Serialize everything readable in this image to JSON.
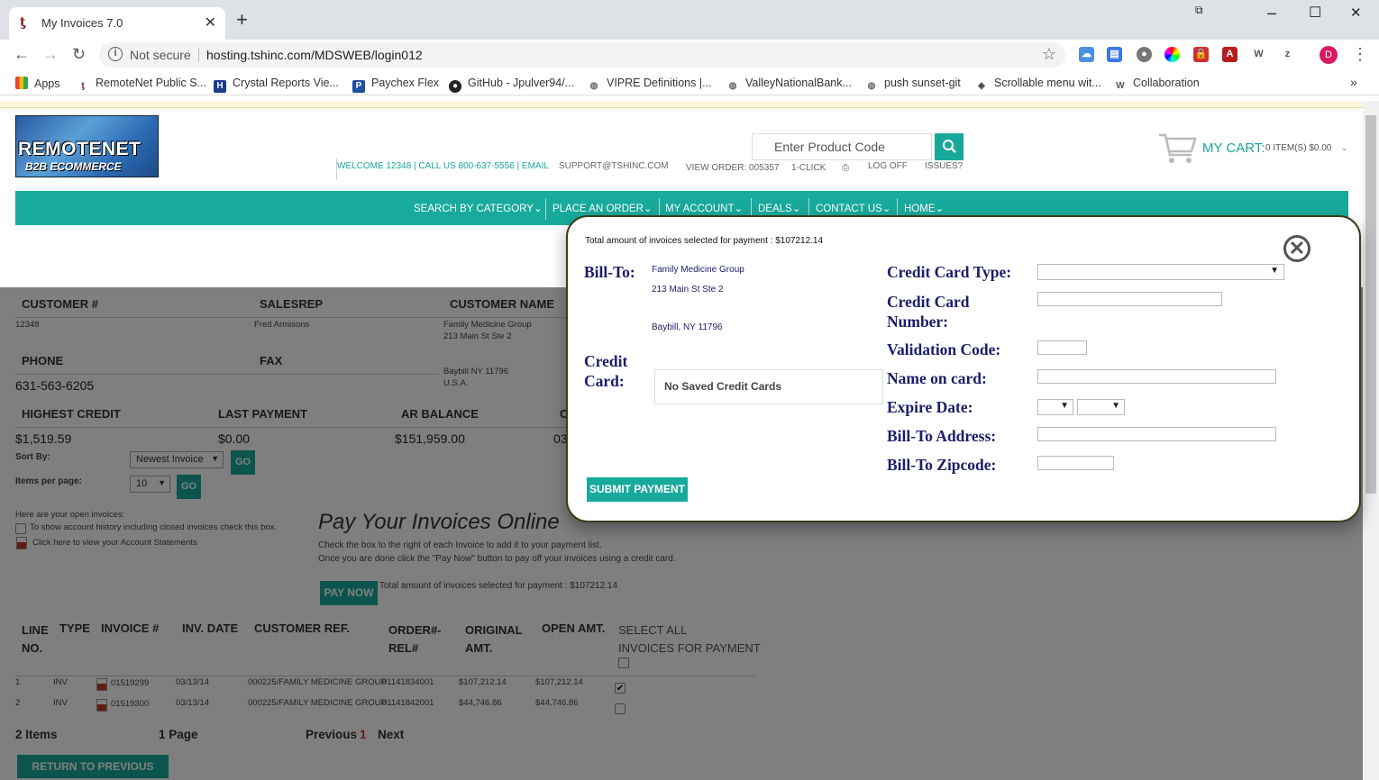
{
  "browser": {
    "tab_title": "My Invoices 7.0",
    "not_secure": "Not secure",
    "url": "hosting.tshinc.com/MDSWEB/login012",
    "bookmarks": [
      {
        "label": "Apps"
      },
      {
        "label": "RemoteNet Public S..."
      },
      {
        "label": "Crystal Reports Vie..."
      },
      {
        "label": "Paychex Flex"
      },
      {
        "label": "GitHub - Jpulver94/..."
      },
      {
        "label": "VIPRE Definitions |..."
      },
      {
        "label": "ValleyNationalBank..."
      },
      {
        "label": "push sunset-git"
      },
      {
        "label": "Scrollable menu wit..."
      },
      {
        "label": "Collaboration"
      }
    ],
    "avatar_letter": "D"
  },
  "site": {
    "logo_line1": "REMOTENET",
    "logo_line2": "B2B ECOMMERCE",
    "search_placeholder": "Enter Product Code",
    "welcome": "WELCOME 12348 | CALL US 800-637-5556 | EMAIL",
    "support_email": "SUPPORT@TSHINC.COM",
    "view_order": "VIEW ORDER: 005357",
    "one_click": "1-CLICK",
    "log_off": "LOG OFF",
    "issues": "ISSUES?",
    "my_cart": "MY CART:",
    "cart_info": "0 ITEM(S) $0.00",
    "nav": [
      "SEARCH BY CATEGORY",
      "PLACE AN ORDER",
      "MY ACCOUNT",
      "DEALS",
      "CONTACT US",
      "HOME"
    ],
    "accent_color": "#18aa9c"
  },
  "account": {
    "headers1": [
      "CUSTOMER #",
      "SALESREP",
      "CUSTOMER NAME"
    ],
    "customer_no": "12348",
    "salesrep": "Fred Armisons",
    "customer_name_lines": [
      "Family Medicine Group",
      "213 Main St Ste 2",
      "",
      "Baybill NY 11796",
      "U.S.A."
    ],
    "headers2": [
      "PHONE",
      "FAX"
    ],
    "phone": "631-563-6205",
    "headers3": [
      "HIGHEST CREDIT",
      "LAST PAYMENT",
      "AR BALANCE",
      "C"
    ],
    "highest_credit": "$1,519.59",
    "last_payment": "$0.00",
    "ar_balance": "$151,959.00",
    "clipped_value": "03"
  },
  "controls": {
    "sort_by_label": "Sort By:",
    "sort_by_value": "Newest Invoice",
    "items_per_page_label": "Items per page:",
    "items_per_page_value": "10",
    "go_label": "GO",
    "open_invoices_text": "Here are your open invoices:",
    "history_text": "To show account history including closed invoices check this box.",
    "statements_text": "Click here to view your Account Statements"
  },
  "pay_online": {
    "title": "Pay Your Invoices Online",
    "line1": "Check the box to the right of each Invoice to add it to your payment list.",
    "line2": "Once you are done click the \"Pay Now\" button to pay off your invoices using a credit card.",
    "pay_now": "PAY NOW",
    "total_text": "Total amount of invoices selected for payment : $107212.14"
  },
  "invoice_table": {
    "headers": [
      "LINE NO.",
      "TYPE",
      "INVOICE #",
      "INV. DATE",
      "CUSTOMER REF.",
      "ORDER#-REL#",
      "ORIGINAL AMT.",
      "OPEN AMT.",
      "SELECT ALL INVOICES FOR PAYMENT"
    ],
    "rows": [
      {
        "line": "1",
        "type": "INV",
        "invoice": "01519299",
        "date": "03/13/14",
        "ref": "000225/FAMILY MEDICINE GROUP",
        "order": "01141834001",
        "original": "$107,212.14",
        "open": "$107,212.14",
        "selected": true
      },
      {
        "line": "2",
        "type": "INV",
        "invoice": "01519300",
        "date": "03/13/14",
        "ref": "000225/FAMILY MEDICINE GROUP",
        "order": "01141842001",
        "original": "$44,746.86",
        "open": "$44,746.86",
        "selected": false
      }
    ],
    "items_count": "2 Items",
    "pages_count": "1 Page",
    "previous": "Previous",
    "current_page": "1",
    "next": "Next",
    "return_button": "RETURN TO PREVIOUS PAGE"
  },
  "modal": {
    "total_text": "Total amount of invoices selected for payment : $107212.14",
    "bill_to_label": "Bill-To:",
    "bill_to_lines": [
      "Family Medicine Group",
      "213 Main St Ste 2",
      "Baybill, NY 11796"
    ],
    "credit_card_label": "Credit Card:",
    "saved_cards_text": "No Saved Credit Cards",
    "fields": {
      "card_type": "Credit Card Type:",
      "card_number": "Credit Card Number:",
      "validation": "Validation Code:",
      "name": "Name on card:",
      "expire": "Expire Date:",
      "address": "Bill-To Address:",
      "zipcode": "Bill-To Zipcode:"
    },
    "submit": "SUBMIT PAYMENT"
  }
}
